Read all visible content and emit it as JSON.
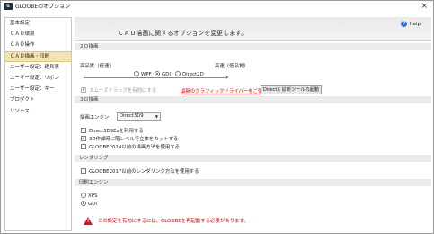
{
  "window": {
    "title": "GLOOBEのオプション",
    "app_icon": "GLOOBE-app-icon",
    "close": "×"
  },
  "sidebar": {
    "items": [
      {
        "label": "基本設定",
        "active": false
      },
      {
        "label": "ＣＡＤ環境",
        "active": false
      },
      {
        "label": "ＣＡＤ操作",
        "active": false
      },
      {
        "label": "ＣＡＤ描画・印刷",
        "active": true
      },
      {
        "label": "ユーザー設定：建具表",
        "active": false
      },
      {
        "label": "ユーザー設定：リボン",
        "active": false
      },
      {
        "label": "ユーザー設定：キー",
        "active": false
      },
      {
        "label": "プロダクト",
        "active": false
      },
      {
        "label": "リソース",
        "active": false
      }
    ]
  },
  "header": {
    "title": "ＣＡＤ描画に関するオプションを変更します。",
    "help_label": "Help"
  },
  "section_2d": {
    "title": "２Ｄ描画",
    "low_label": "高品質（低速）",
    "high_label": "高速（低品質）",
    "radios": [
      {
        "label": "WPF",
        "selected": false
      },
      {
        "label": "GDI",
        "selected": true
      },
      {
        "label": "Direct2D",
        "selected": false
      }
    ],
    "smooth_drag_label": "スムーズドラッグを有効にする",
    "driver_link": "最新のグラフィックドライバーをご使用ください。",
    "diag_button": "DirectX 診断ツールの起動"
  },
  "section_3d": {
    "title": "３Ｄ描画",
    "engine_label": "描画エンジン",
    "engine_value": "Direct3D9",
    "checks": [
      {
        "label": "Direct3D9Exを利用する",
        "checked": false
      },
      {
        "label": "3D作成時に階レベルで立体をカットする",
        "checked": true
      },
      {
        "label": "GLOOBE2014以前の描画方法を使用する",
        "checked": false
      }
    ]
  },
  "section_render": {
    "title": "レンダリング",
    "check_label": "GLOOBE2017以前のレンダリング方法を使用する",
    "checked": false
  },
  "section_print": {
    "title": "印刷エンジン",
    "radios": [
      {
        "label": "XPS",
        "selected": false
      },
      {
        "label": "GDI",
        "selected": true
      }
    ]
  },
  "warning": {
    "text": "この設定を有効にするには、GLOOBEを再起動する必要があります。",
    "color": "#c00000"
  }
}
